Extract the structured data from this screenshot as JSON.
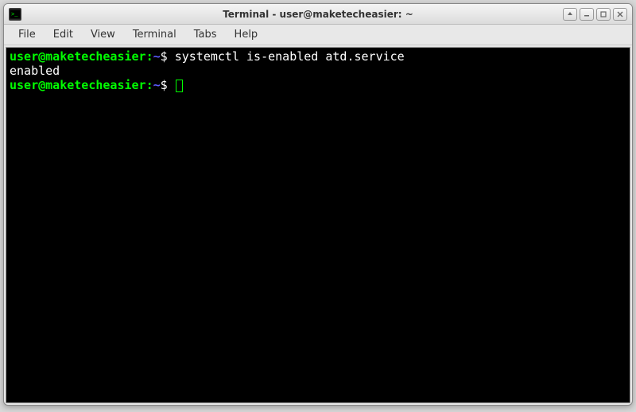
{
  "window": {
    "title": "Terminal - user@maketecheasier: ~"
  },
  "menubar": {
    "items": [
      "File",
      "Edit",
      "View",
      "Terminal",
      "Tabs",
      "Help"
    ]
  },
  "terminal": {
    "prompt_user": "user@maketecheasier",
    "prompt_sep": ":",
    "prompt_path": "~",
    "prompt_symbol": "$",
    "lines": [
      {
        "type": "prompt",
        "command": "systemctl is-enabled atd.service"
      },
      {
        "type": "output",
        "text": "enabled"
      },
      {
        "type": "prompt",
        "command": "",
        "cursor": true
      }
    ]
  },
  "controls": {
    "stick": "▾",
    "minimize": "—",
    "maximize": "▢",
    "close": "✕"
  }
}
